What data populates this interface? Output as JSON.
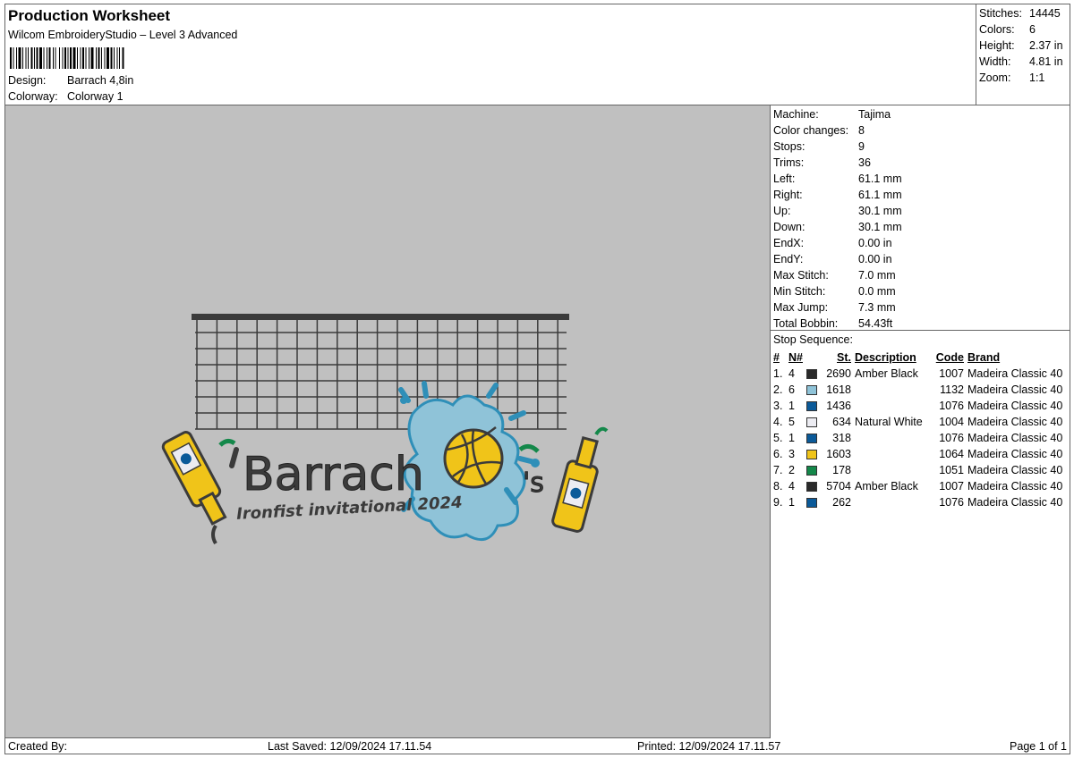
{
  "header": {
    "title": "Production Worksheet",
    "subtitle": "Wilcom EmbroideryStudio – Level 3 Advanced",
    "design_label": "Design:",
    "design_value": "Barrach 4,8in",
    "colorway_label": "Colorway:",
    "colorway_value": "Colorway 1"
  },
  "summary": [
    {
      "label": "Stitches:",
      "value": "14445"
    },
    {
      "label": "Colors:",
      "value": "6"
    },
    {
      "label": "Height:",
      "value": "2.37 in"
    },
    {
      "label": "Width:",
      "value": "4.81 in"
    },
    {
      "label": "Zoom:",
      "value": "1:1"
    }
  ],
  "machine_info": [
    {
      "label": "Machine:",
      "value": "Tajima"
    },
    {
      "label": "Color changes:",
      "value": "8"
    },
    {
      "label": "Stops:",
      "value": "9"
    },
    {
      "label": "Trims:",
      "value": "36"
    },
    {
      "label": "Left:",
      "value": "61.1 mm"
    },
    {
      "label": "Right:",
      "value": "61.1 mm"
    },
    {
      "label": "Up:",
      "value": "30.1 mm"
    },
    {
      "label": "Down:",
      "value": "30.1 mm"
    },
    {
      "label": "EndX:",
      "value": "0.00 in"
    },
    {
      "label": "EndY:",
      "value": "0.00 in"
    },
    {
      "label": "Max Stitch:",
      "value": "7.0 mm"
    },
    {
      "label": "Min Stitch:",
      "value": "0.0 mm"
    },
    {
      "label": "Max Jump:",
      "value": "7.3 mm"
    },
    {
      "label": "Total Bobbin:",
      "value": "54.43ft"
    }
  ],
  "stop_sequence": {
    "title": "Stop Sequence:",
    "headers": {
      "num": "#",
      "n": "N#",
      "st": "St.",
      "desc": "Description",
      "code": "Code",
      "brand": "Brand"
    },
    "rows": [
      {
        "num": "1.",
        "n": "4",
        "color": "#2a2a2a",
        "st": "2690",
        "desc": "Amber Black",
        "code": "1007",
        "brand": "Madeira Classic 40"
      },
      {
        "num": "2.",
        "n": "6",
        "color": "#8fc3d8",
        "st": "1618",
        "desc": "",
        "code": "1132",
        "brand": "Madeira Classic 40"
      },
      {
        "num": "3.",
        "n": "1",
        "color": "#0b5a99",
        "st": "1436",
        "desc": "",
        "code": "1076",
        "brand": "Madeira Classic 40"
      },
      {
        "num": "4.",
        "n": "5",
        "color": "#ececf2",
        "st": "634",
        "desc": "Natural White",
        "code": "1004",
        "brand": "Madeira Classic 40"
      },
      {
        "num": "5.",
        "n": "1",
        "color": "#0b5a99",
        "st": "318",
        "desc": "",
        "code": "1076",
        "brand": "Madeira Classic 40"
      },
      {
        "num": "6.",
        "n": "3",
        "color": "#f0c419",
        "st": "1603",
        "desc": "",
        "code": "1064",
        "brand": "Madeira Classic 40"
      },
      {
        "num": "7.",
        "n": "2",
        "color": "#14884a",
        "st": "178",
        "desc": "",
        "code": "1051",
        "brand": "Madeira Classic 40"
      },
      {
        "num": "8.",
        "n": "4",
        "color": "#2a2a2a",
        "st": "5704",
        "desc": "Amber Black",
        "code": "1007",
        "brand": "Madeira Classic 40"
      },
      {
        "num": "9.",
        "n": "1",
        "color": "#0b5a99",
        "st": "262",
        "desc": "",
        "code": "1076",
        "brand": "Madeira Classic 40"
      }
    ]
  },
  "design": {
    "text_main": "Barrach",
    "text_s": "'s",
    "text_sub": "Ironfist invitational 2024",
    "background": "#c0c0c0",
    "thread_dark": "#3b3b3b",
    "thread_yellow": "#f0c419",
    "thread_blue": "#2f8fb8",
    "thread_lightblue": "#8fc3d8",
    "thread_green": "#14884a"
  },
  "footer": {
    "created_by": "Created By:",
    "last_saved": "Last Saved: 12/09/2024 17.11.54",
    "printed": "Printed: 12/09/2024 17.11.57",
    "page": "Page 1 of 1"
  }
}
